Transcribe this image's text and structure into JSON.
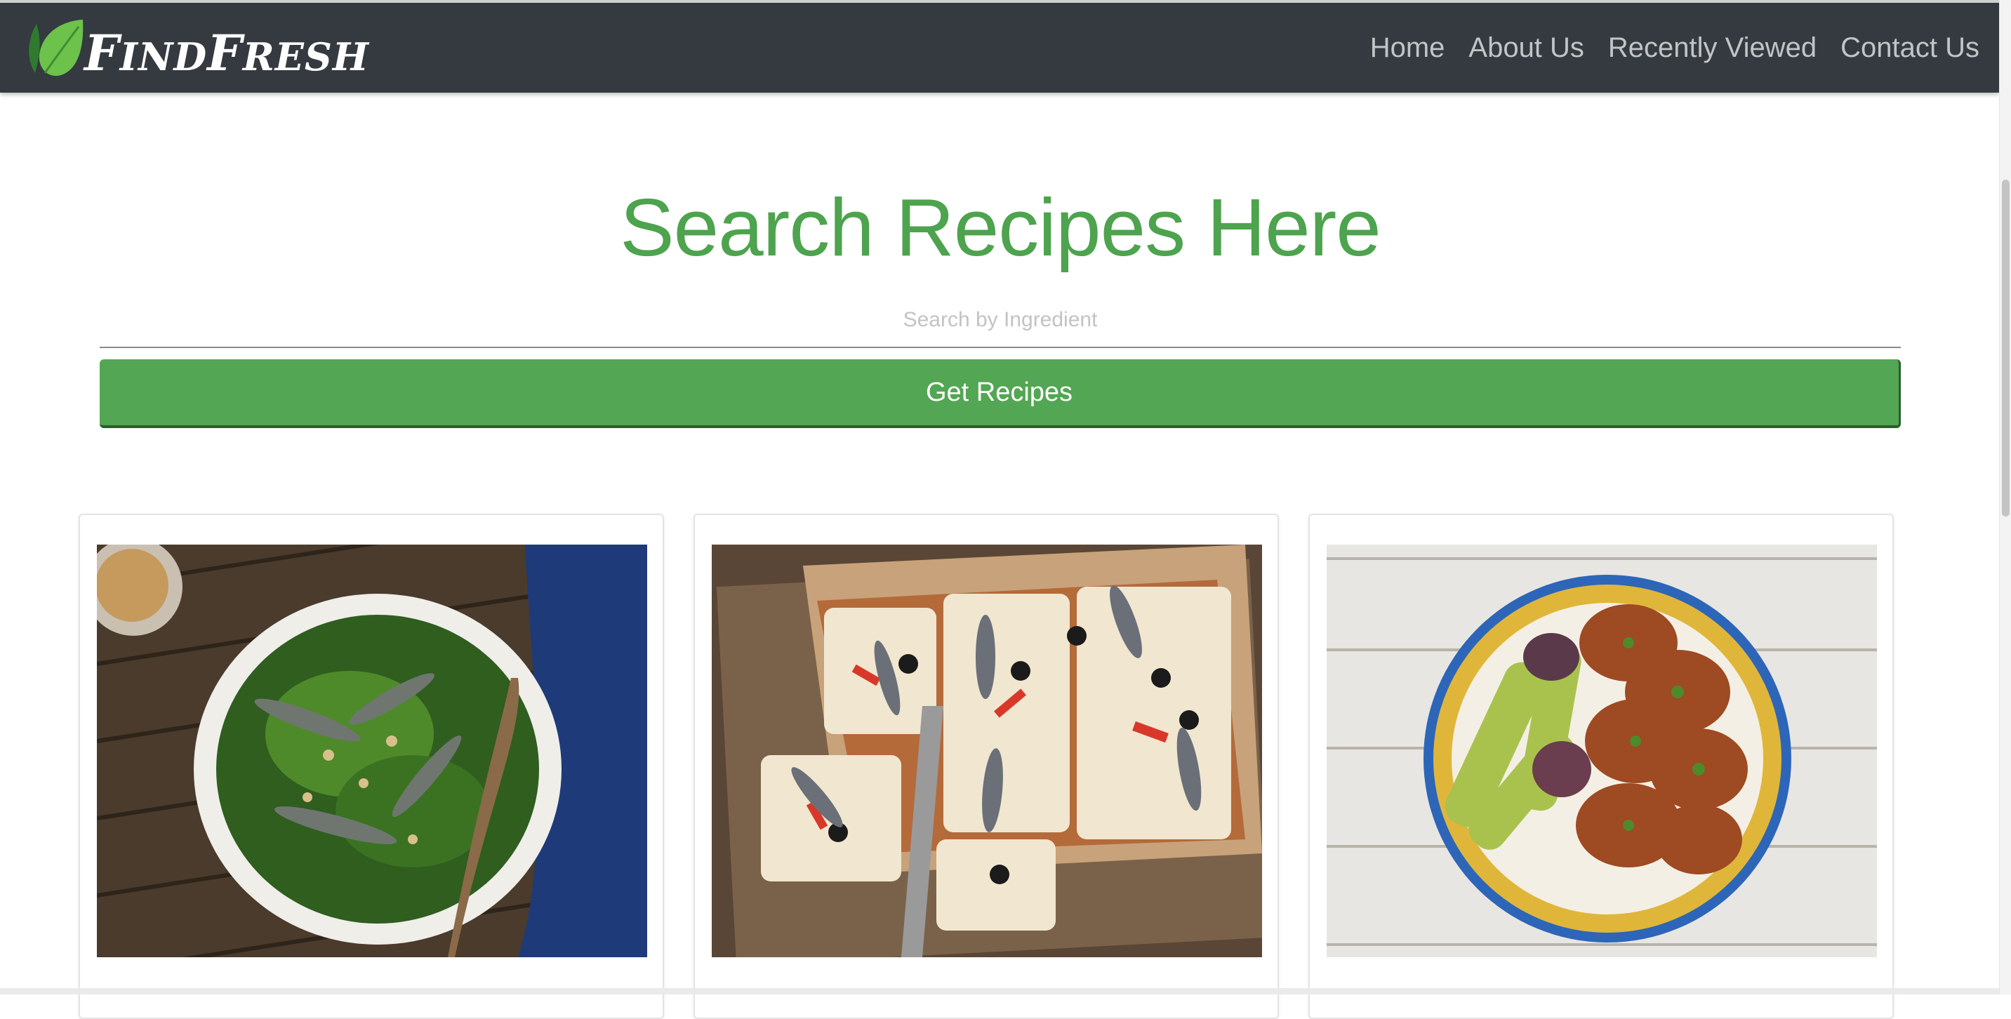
{
  "navbar": {
    "brand_text_f1": "F",
    "brand_text_ind": "IND",
    "brand_text_f2": "F",
    "brand_text_resh": "RESH",
    "links": [
      {
        "label": "Home"
      },
      {
        "label": "About Us"
      },
      {
        "label": "Recently Viewed"
      },
      {
        "label": "Contact Us"
      }
    ]
  },
  "hero": {
    "title": "Search Recipes Here",
    "search_placeholder": "Search by Ingredient",
    "button_label": "Get Recipes"
  },
  "recipes": [
    {
      "image": "sardine-broccoli-salad-photo"
    },
    {
      "image": "sardine-flatbread-pizza-photo"
    },
    {
      "image": "grilled-chicken-zucchini-platter-photo"
    }
  ],
  "colors": {
    "navbar_bg": "#343a40",
    "accent_green": "#4ea34e",
    "button_green": "#53a653",
    "nav_link": "#c2c4c6"
  }
}
